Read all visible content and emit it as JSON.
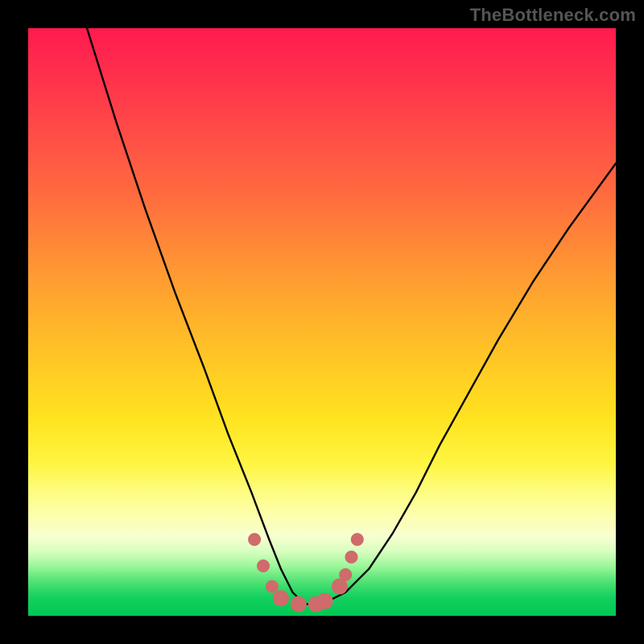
{
  "watermark": "TheBottleneck.com",
  "chart_data": {
    "type": "line",
    "title": "",
    "xlabel": "",
    "ylabel": "",
    "xlim": [
      0,
      100
    ],
    "ylim": [
      0,
      100
    ],
    "series": [
      {
        "name": "bottleneck-curve",
        "x": [
          10,
          15,
          20,
          25,
          30,
          34,
          38,
          41,
          43,
          45,
          47,
          50,
          54,
          58,
          62,
          66,
          70,
          75,
          80,
          86,
          92,
          100
        ],
        "y": [
          100,
          84,
          69,
          55,
          42,
          31,
          21,
          13,
          8,
          4,
          2,
          2,
          4,
          8,
          14,
          21,
          29,
          38,
          47,
          57,
          66,
          77
        ]
      }
    ],
    "markers": {
      "name": "highlight-dots",
      "color": "#cf6b6b",
      "points": [
        {
          "x": 38.5,
          "y": 13
        },
        {
          "x": 40.0,
          "y": 8.5
        },
        {
          "x": 41.5,
          "y": 5
        },
        {
          "x": 43.0,
          "y": 3
        },
        {
          "x": 46.0,
          "y": 2
        },
        {
          "x": 49.0,
          "y": 2
        },
        {
          "x": 50.5,
          "y": 2.5
        },
        {
          "x": 53.0,
          "y": 5
        },
        {
          "x": 54.0,
          "y": 7
        },
        {
          "x": 55.0,
          "y": 10
        },
        {
          "x": 56.0,
          "y": 13
        }
      ]
    }
  }
}
